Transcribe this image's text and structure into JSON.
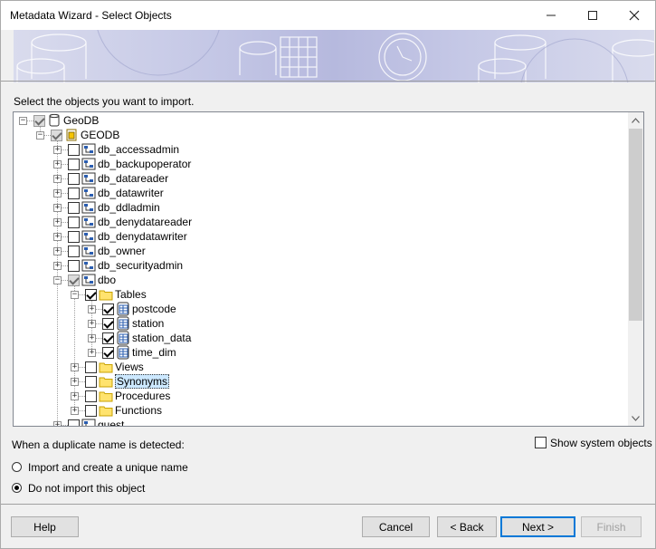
{
  "window": {
    "title": "Metadata Wizard - Select Objects"
  },
  "prompt": "Select the objects you want to import.",
  "tree": [
    {
      "label": "GeoDB",
      "icon": "database-icon",
      "level": 0,
      "expander": "minus",
      "check": "partial"
    },
    {
      "label": "GEODB",
      "icon": "catalog-icon",
      "level": 1,
      "expander": "minus",
      "check": "partial"
    },
    {
      "label": "db_accessadmin",
      "icon": "schema-icon",
      "level": 2,
      "expander": "plus",
      "check": "none"
    },
    {
      "label": "db_backupoperator",
      "icon": "schema-icon",
      "level": 2,
      "expander": "plus",
      "check": "none"
    },
    {
      "label": "db_datareader",
      "icon": "schema-icon",
      "level": 2,
      "expander": "plus",
      "check": "none"
    },
    {
      "label": "db_datawriter",
      "icon": "schema-icon",
      "level": 2,
      "expander": "plus",
      "check": "none"
    },
    {
      "label": "db_ddladmin",
      "icon": "schema-icon",
      "level": 2,
      "expander": "plus",
      "check": "none"
    },
    {
      "label": "db_denydatareader",
      "icon": "schema-icon",
      "level": 2,
      "expander": "plus",
      "check": "none"
    },
    {
      "label": "db_denydatawriter",
      "icon": "schema-icon",
      "level": 2,
      "expander": "plus",
      "check": "none"
    },
    {
      "label": "db_owner",
      "icon": "schema-icon",
      "level": 2,
      "expander": "plus",
      "check": "none"
    },
    {
      "label": "db_securityadmin",
      "icon": "schema-icon",
      "level": 2,
      "expander": "plus",
      "check": "none"
    },
    {
      "label": "dbo",
      "icon": "schema-icon",
      "level": 2,
      "expander": "minus",
      "check": "partial"
    },
    {
      "label": "Tables",
      "icon": "folder-icon",
      "level": 3,
      "expander": "minus",
      "check": "checked"
    },
    {
      "label": "postcode",
      "icon": "table-icon",
      "level": 4,
      "expander": "plus",
      "check": "checked"
    },
    {
      "label": "station",
      "icon": "table-icon",
      "level": 4,
      "expander": "plus",
      "check": "checked"
    },
    {
      "label": "station_data",
      "icon": "table-icon",
      "level": 4,
      "expander": "plus",
      "check": "checked"
    },
    {
      "label": "time_dim",
      "icon": "table-icon",
      "level": 4,
      "expander": "plus",
      "check": "checked"
    },
    {
      "label": "Views",
      "icon": "folder-icon",
      "level": 3,
      "expander": "plus",
      "check": "none"
    },
    {
      "label": "Synonyms",
      "icon": "folder-icon",
      "level": 3,
      "expander": "plus",
      "check": "none",
      "selected": true
    },
    {
      "label": "Procedures",
      "icon": "folder-icon",
      "level": 3,
      "expander": "plus",
      "check": "none"
    },
    {
      "label": "Functions",
      "icon": "folder-icon",
      "level": 3,
      "expander": "plus",
      "check": "none"
    },
    {
      "label": "guest",
      "icon": "schema-icon",
      "level": 2,
      "expander": "plus",
      "check": "none"
    }
  ],
  "duplicate": {
    "label": "When a duplicate name is detected:",
    "options": [
      {
        "label": "Import and create a unique name",
        "selected": false
      },
      {
        "label": "Do not import this object",
        "selected": true
      }
    ]
  },
  "show_system": {
    "label": "Show system objects",
    "checked": false
  },
  "buttons": {
    "help": "Help",
    "cancel": "Cancel",
    "back": "< Back",
    "next": "Next >",
    "finish": "Finish"
  }
}
